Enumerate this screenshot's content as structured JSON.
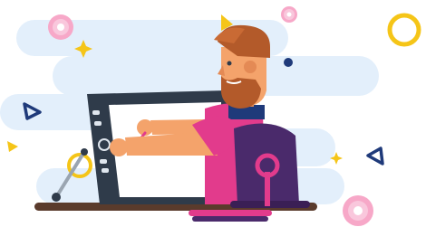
{
  "illustration": {
    "subject": "designer-at-drawing-tablet",
    "colors": {
      "background": "#ffffff",
      "cloud": "#e3effb",
      "tablet_frame": "#2f3b4a",
      "tablet_screen": "#ffffff",
      "desk": "#5a3b2c",
      "chair": "#4a2a6b",
      "chair_accent": "#e23b8c",
      "shirt": "#e23b8c",
      "skin": "#f4a36b",
      "hair_beard": "#b35a2a",
      "accent_yellow": "#f5c518",
      "accent_navy": "#1f3a7a",
      "donut_pink": "#f7a8c8"
    },
    "decorations": [
      "donut-icon",
      "triangle-icon",
      "sparkle-icon",
      "ring-icon",
      "dot-icon"
    ]
  }
}
